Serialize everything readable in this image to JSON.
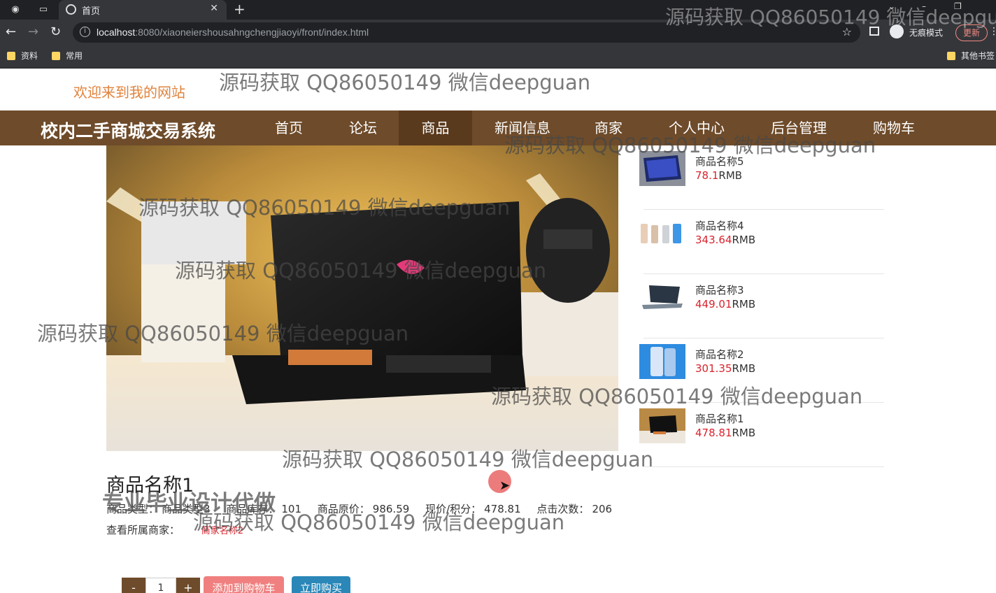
{
  "browser": {
    "tab_title": "首页",
    "url_host": "localhost",
    "url_rest": ":8080/xiaoneiershousahngchengjiaoyi/front/index.html",
    "incognito_label": "无痕模式",
    "update_label": "更新",
    "bookmarks": [
      "资料",
      "常用"
    ],
    "other_bookmarks": "其他书签"
  },
  "header": {
    "welcome": "欢迎来到我的网站",
    "site_title": "校内二手商城交易系统",
    "nav": [
      "首页",
      "论坛",
      "商品",
      "新闻信息",
      "商家",
      "个人中心",
      "后台管理",
      "购物车"
    ],
    "active_nav": "商品"
  },
  "side_list": [
    {
      "name": "商品名称5",
      "price": "78.1",
      "unit": "RMB"
    },
    {
      "name": "商品名称4",
      "price": "343.64",
      "unit": "RMB"
    },
    {
      "name": "商品名称3",
      "price": "449.01",
      "unit": "RMB"
    },
    {
      "name": "商品名称2",
      "price": "301.35",
      "unit": "RMB"
    },
    {
      "name": "商品名称1",
      "price": "478.81",
      "unit": "RMB"
    }
  ],
  "product": {
    "title": "商品名称1",
    "type_label": "商品类型：",
    "type_value": "商品类型3",
    "stock_label": "商品库存：",
    "stock_value": "101",
    "orig_price_label": "商品原价：",
    "orig_price_value": "986.59",
    "price_label": "现价/积分：",
    "price_value": "478.81",
    "clicks_label": "点击次数：",
    "clicks_value": "206",
    "seller_label": "查看所属商家：",
    "seller_value": "商家名称2"
  },
  "actions": {
    "minus": "-",
    "qty": "1",
    "plus": "+",
    "add_cart": "添加到购物车",
    "buy_now": "立即购买"
  },
  "watermark": "源码获取 QQ86050149 微信deepguan",
  "watermark_top": "源码获取 QQ86050149 微信deepgu",
  "watermark_ad": "专业毕业设计代做",
  "colors": {
    "nav_bg": "#6e4b2a",
    "price_red": "#d9232d",
    "welcome_orange": "#e0833c"
  }
}
